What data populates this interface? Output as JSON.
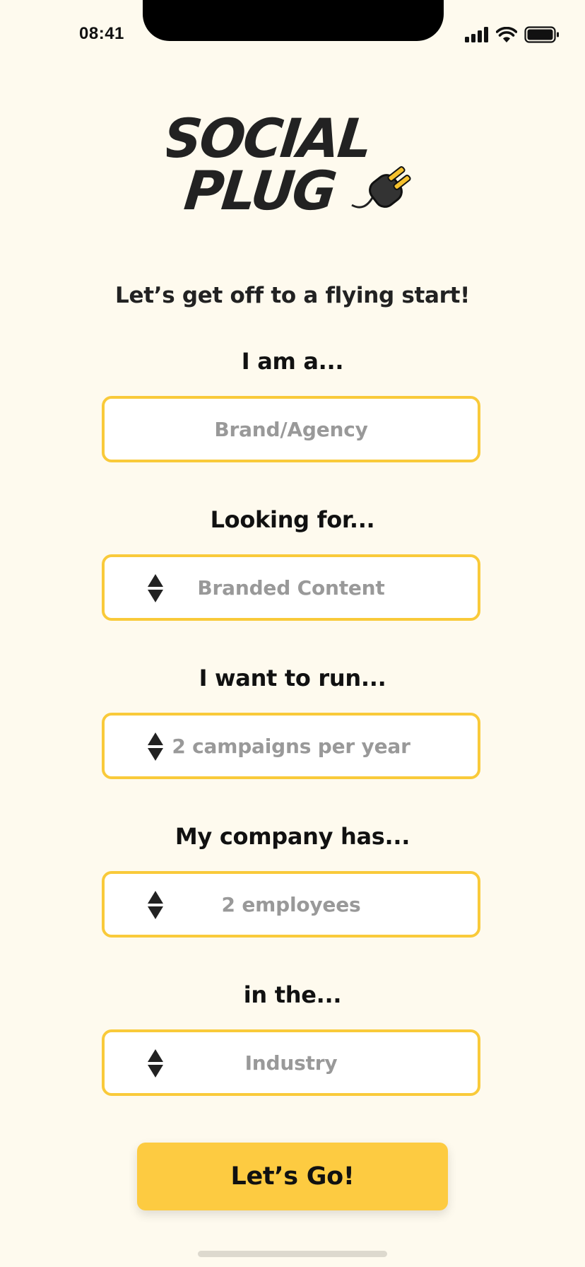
{
  "status_bar": {
    "time": "08:41"
  },
  "brand": {
    "line1": "SOCIAL",
    "line2": "PLUG"
  },
  "heading": "Let’s get off to a flying start!",
  "form": {
    "role": {
      "label": "I am a...",
      "value": "Brand/Agency"
    },
    "looking_for": {
      "label": "Looking for...",
      "value": "Branded Content"
    },
    "campaigns": {
      "label": "I want to run...",
      "value": "2 campaigns per year"
    },
    "company_size": {
      "label": "My company has...",
      "value": "2 employees"
    },
    "industry": {
      "label": "in the...",
      "value": "Industry"
    }
  },
  "submit_label": "Let’s Go!",
  "colors": {
    "background": "#FEFAEE",
    "accent": "#F9CA3A",
    "button": "#FDCB41",
    "placeholder": "#999999"
  },
  "icons": [
    "signal-icon",
    "wifi-icon",
    "battery-icon",
    "plug-icon",
    "stepper-icon"
  ]
}
